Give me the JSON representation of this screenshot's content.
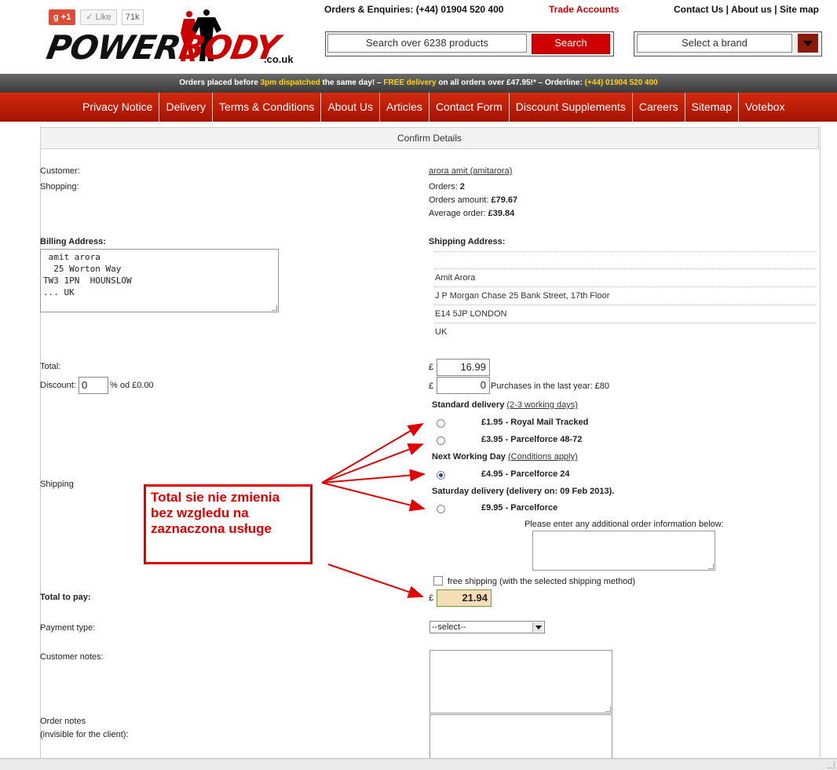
{
  "header": {
    "gplus_label": "+1",
    "like_label": "Like",
    "like_count": "71k",
    "logo_main": "POWER",
    "logo_second": "BODY",
    "logo_domain": ".co.uk",
    "orders_enquiries": "Orders & Enquiries: (+44) 01904 520 400",
    "trade_accounts": "Trade Accounts",
    "contact_us": "Contact Us",
    "about_us": "About us",
    "site_map": "Site map",
    "search_placeholder": "Search over 6238 products",
    "search_button": "Search",
    "brand_select": "Select a brand"
  },
  "infobar": {
    "p1": "Orders placed before ",
    "p2": "3pm dispatched",
    "p3": " the same day!   –   ",
    "p4": "FREE delivery",
    "p5": " on all orders over £47.95!*   –   Orderline: ",
    "p6": "(+44) 01904 520 400"
  },
  "nav": [
    "Privacy Notice",
    "Delivery",
    "Terms & Conditions",
    "About Us",
    "Articles",
    "Contact Form",
    "Discount Supplements",
    "Careers",
    "Sitemap",
    "Votebox"
  ],
  "panel_title": "Confirm Details",
  "customer": {
    "label": "Customer:",
    "value": "arora amit (amitarora)",
    "shopping_label": "Shopping:",
    "orders_label": "Orders:",
    "orders_value": "2",
    "amount_label": "Orders amount:",
    "amount_value": "£79.67",
    "avg_label": "Average order:",
    "avg_value": "£39.84"
  },
  "billing": {
    "label": "Billing Address:",
    "text": " amit arora\n  25 Worton Way\nTW3 1PN  HOUNSLOW\n... UK"
  },
  "shipping_address": {
    "label": "Shipping Address:",
    "lines": [
      "Amit Arora",
      "J P Morgan Chase 25 Bank Street, 17th Floor",
      "E14 5JP LONDON",
      "UK"
    ]
  },
  "totals": {
    "total_label": "Total:",
    "currency": "£",
    "total_value": "16.99",
    "discount_label": "Discount:",
    "discount_value": "0",
    "discount_suffix": "% od £0.00",
    "discount_amount": "0",
    "purchases_note": "Purchases in the last year: £80"
  },
  "shipping": {
    "label": "Shipping",
    "standard_title": "Standard delivery",
    "standard_link": "(2-3 working days)",
    "opt1": "£1.95 - Royal Mail Tracked",
    "opt2": "£3.95 - Parcelforce 48-72",
    "next_title": "Next Working Day",
    "next_link": "(Conditions apply)",
    "opt3": "£4.95 - Parcelforce 24",
    "saturday_title": "Saturday delivery (delivery on: 09 Feb 2013).",
    "opt4": "£9.95 - Parcelforce",
    "selected": 3,
    "additional_info": "Please enter any additional order information below:",
    "free_shipping": "free shipping (with the selected shipping method)"
  },
  "total_to_pay": {
    "label": "Total to pay:",
    "value": "21.94"
  },
  "payment": {
    "label": "Payment type:",
    "selected": "--select--"
  },
  "notes": {
    "customer_label": "Customer notes:",
    "order_label": "Order notes",
    "order_sub": "(invisible for the client):"
  },
  "annotation": "Total sie nie zmienia bez wzgledu na zaznaczona usługe",
  "colors": {
    "brand_red": "#cc0000",
    "nav_red": "#c21e08",
    "annotation_red": "#e00000",
    "highlight_total": "#f5deb3"
  }
}
